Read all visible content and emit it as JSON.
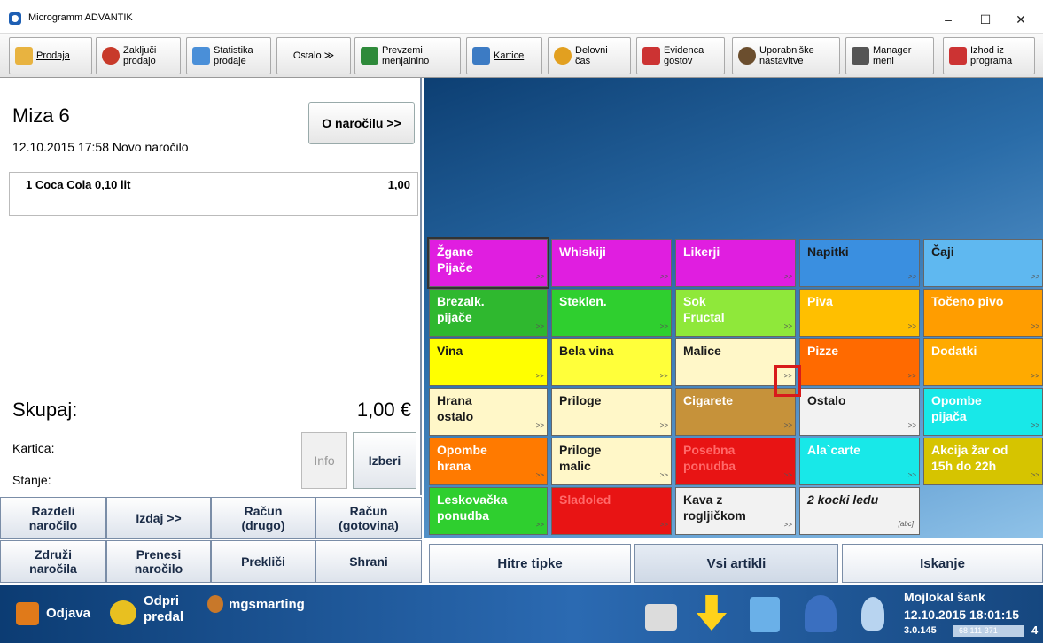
{
  "window": {
    "title": "Microgramm ADVANTIK",
    "controls": [
      "–",
      "☐",
      "✕"
    ]
  },
  "toolbar": [
    {
      "label": "Prodaja",
      "icon": "sales-icon",
      "color": "#e8b340"
    },
    {
      "label": "Zaključi\nprodajo",
      "icon": "close-sale-icon",
      "color": "#c83a2a"
    },
    {
      "label": "Statistika\nprodaje",
      "icon": "statistics-icon",
      "color": "#4a8fd8"
    },
    {
      "label": "Ostalo ≫",
      "icon": "",
      "color": ""
    },
    {
      "label": "Prevzemi\nmenjalnino",
      "icon": "cash-icon",
      "color": "#2e8a3a"
    },
    {
      "label": "Kartice",
      "icon": "cards-icon",
      "color": "#3c7bc4"
    },
    {
      "label": "Delovni\nčas",
      "icon": "clock-icon",
      "color": "#e2a020"
    },
    {
      "label": "Evidenca\ngostov",
      "icon": "guests-icon",
      "color": "#c33"
    },
    {
      "label": "Uporabniške\nnastavitve",
      "icon": "user-settings-icon",
      "color": "#6b4e2e"
    },
    {
      "label": "Manager\nmeni",
      "icon": "manager-icon",
      "color": "#555"
    },
    {
      "label": "Izhod iz\nprograma",
      "icon": "exit-icon",
      "color": "#c33"
    }
  ],
  "order": {
    "table": "Miza 6",
    "datetime": "12.10.2015 17:58 Novo naročilo",
    "about_button": "O naročilu >>",
    "items": [
      {
        "name": "1 Coca Cola 0,10 lit",
        "amount": "1,00"
      }
    ],
    "total_label": "Skupaj:",
    "total_value": "1,00 €",
    "card_label": "Kartica:",
    "balance_label": "Stanje:",
    "info_button": "Info",
    "select_button": "Izberi"
  },
  "actions": {
    "split": "Razdeli\nnaročilo",
    "issue": "Izdaj >>",
    "invoice_other": "Račun\n(drugo)",
    "invoice_cash": "Račun\n(gotovina)",
    "merge": "Združi\nnaročila",
    "transfer": "Prenesi\nnaročilo",
    "cancel": "Prekliči",
    "save": "Shrani"
  },
  "categories": [
    {
      "label": "Žgane\nPijače",
      "bg": "#e01ee0",
      "fg": "#ffffff"
    },
    {
      "label": "Whiskiji",
      "bg": "#e01ee0",
      "fg": "#ffffff"
    },
    {
      "label": "Likerji",
      "bg": "#e01ee0",
      "fg": "#ffffff"
    },
    {
      "label": "Napitki",
      "bg": "#3a8fe0",
      "fg": "#1a1a1a"
    },
    {
      "label": "Čaji",
      "bg": "#5fb8f0",
      "fg": "#1a1a1a"
    },
    {
      "label": "Brezalk.\npijače",
      "bg": "#2fb82f",
      "fg": "#ffffff"
    },
    {
      "label": "Steklen.",
      "bg": "#2fcf2f",
      "fg": "#ffffff"
    },
    {
      "label": "Sok\nFructal",
      "bg": "#8fe83a",
      "fg": "#ffffff"
    },
    {
      "label": "Piva",
      "bg": "#ffbf00",
      "fg": "#ffffff"
    },
    {
      "label": "Točeno pivo",
      "bg": "#ff9d00",
      "fg": "#ffffff"
    },
    {
      "label": "Vina",
      "bg": "#ffff00",
      "fg": "#1a1a1a"
    },
    {
      "label": "Bela vina",
      "bg": "#ffff3a",
      "fg": "#1a1a1a"
    },
    {
      "label": "Malice",
      "bg": "#fff7c8",
      "fg": "#1a1a1a"
    },
    {
      "label": "Pizze",
      "bg": "#ff6a00",
      "fg": "#ffffff"
    },
    {
      "label": "Dodatki",
      "bg": "#ffaa00",
      "fg": "#ffffff"
    },
    {
      "label": "Hrana\nostalo",
      "bg": "#fff7c8",
      "fg": "#1a1a1a"
    },
    {
      "label": "Priloge",
      "bg": "#fff7c8",
      "fg": "#1a1a1a"
    },
    {
      "label": "Cigarete",
      "bg": "#c6923a",
      "fg": "#ffffff"
    },
    {
      "label": "Ostalo",
      "bg": "#f2f2f2",
      "fg": "#1a1a1a"
    },
    {
      "label": "Opombe\npijača",
      "bg": "#18e8e8",
      "fg": "#ffffff"
    },
    {
      "label": "Opombe\nhrana",
      "bg": "#ff7a00",
      "fg": "#ffffff"
    },
    {
      "label": "Priloge\nmalic",
      "bg": "#fff7c8",
      "fg": "#1a1a1a"
    },
    {
      "label": "Posebna\nponudba",
      "bg": "#e81414",
      "fg": "#ff6a6a"
    },
    {
      "label": "Ala`carte",
      "bg": "#18e8e8",
      "fg": "#ffffff"
    },
    {
      "label": "Akcija žar od\n15h do 22h",
      "bg": "#d6c400",
      "fg": "#ffffff"
    },
    {
      "label": "Leskovačka\nponudba",
      "bg": "#2fcf2f",
      "fg": "#ffffff"
    },
    {
      "label": "Sladoled",
      "bg": "#e81414",
      "fg": "#ff6a6a"
    },
    {
      "label": "Kava z\nrogljičkom",
      "bg": "#f2f2f2",
      "fg": "#1a1a1a"
    },
    {
      "label": "2 kocki ledu",
      "bg": "#f2f2f2",
      "fg": "#1a1a1a",
      "tag": "[abc]",
      "italic": true
    }
  ],
  "more_marker": ">>",
  "tabs": {
    "quick": "Hitre tipke",
    "all": "Vsi artikli",
    "search": "Iskanje"
  },
  "status": {
    "logout": "Odjava",
    "open_drawer": "Odpri\npredal",
    "user": "mgsmarting",
    "location": "Mojlokal šank",
    "clock": "12.10.2015 18:01:15",
    "version": "3.0.145",
    "counter": "68 111 371",
    "extra": "4"
  }
}
